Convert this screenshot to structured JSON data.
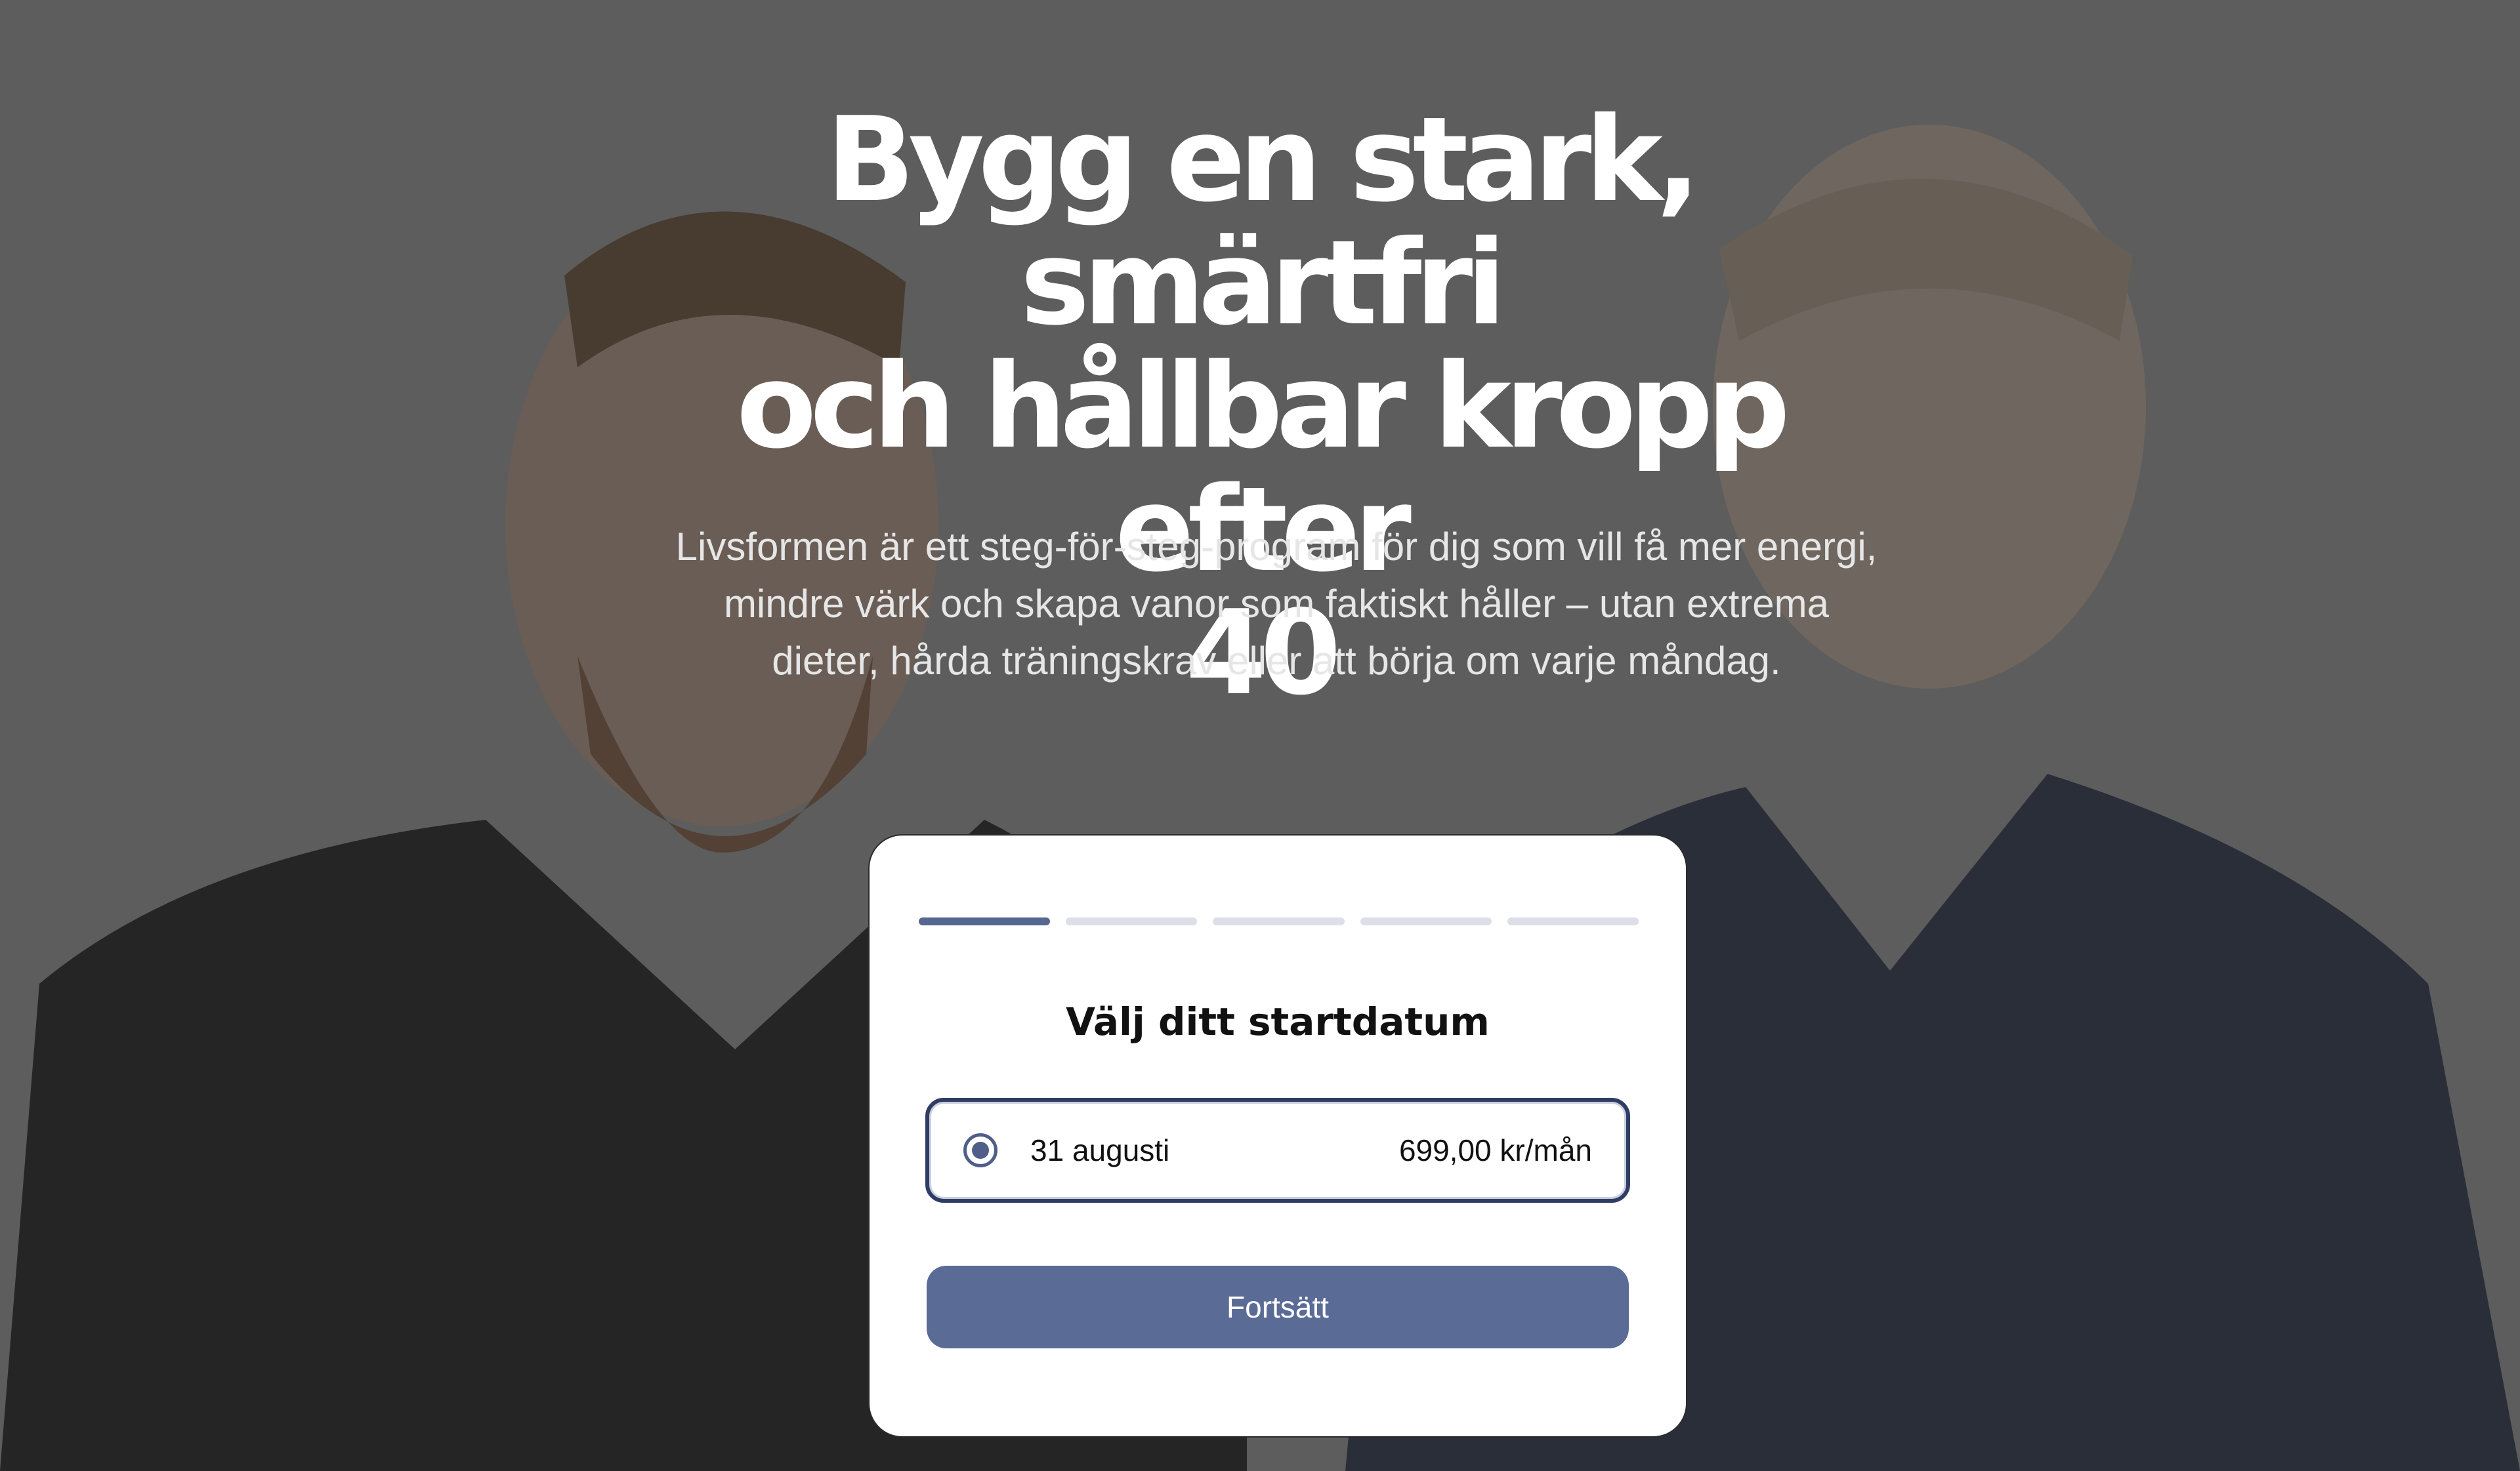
{
  "hero": {
    "headline_line1": "Bygg en stark, smärtfri",
    "headline_line2": "och hållbar kropp efter",
    "headline_line3": "40",
    "subtext": "Livsformen är ett steg-för-steg-program för dig som vill få mer energi, mindre värk och skapa vanor som faktiskt håller – utan extrema dieter, hårda träningskrav eller att börja om varje måndag."
  },
  "card": {
    "progress": {
      "total_steps": 5,
      "current_step": 1
    },
    "title": "Välj ditt startdatum",
    "option": {
      "date": "31 augusti",
      "price": "699,00 kr/mån",
      "selected": true
    },
    "continue_label": "Fortsätt"
  },
  "colors": {
    "accent": "#5a6b96",
    "option_border": "#2f3c63",
    "progress_active": "#56678f",
    "progress_inactive": "#dcdfe8"
  }
}
